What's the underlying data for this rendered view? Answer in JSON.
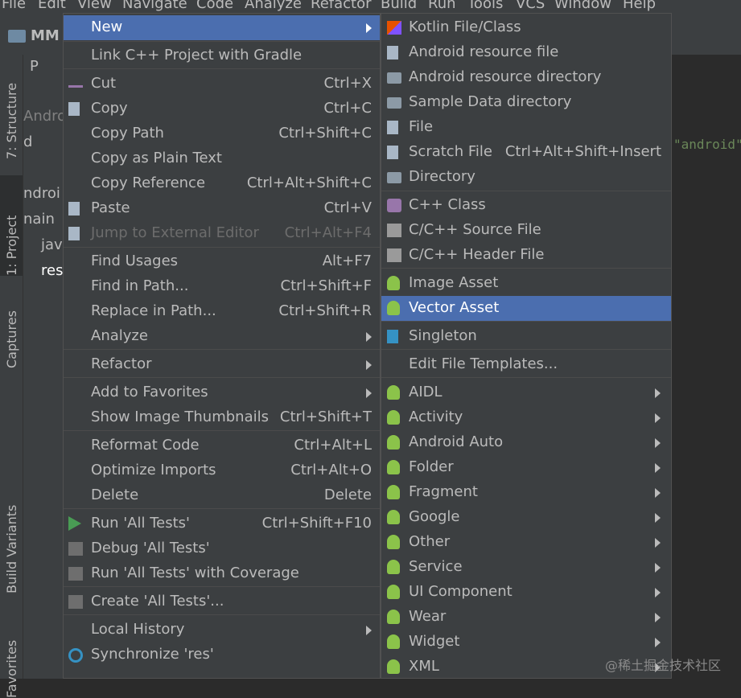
{
  "menubar": [
    "File",
    "Edit",
    "View",
    "Navigate",
    "Code",
    "Analyze",
    "Refactor",
    "Build",
    "Run",
    "Tools",
    "VCS",
    "Window",
    "Help"
  ],
  "project": {
    "name": "MM"
  },
  "side_tabs": [
    "7: Structure",
    "1: Project",
    "Captures",
    "Build Variants",
    "Favorites"
  ],
  "tree_text": [
    "P",
    "Andro",
    "d",
    "ndroi",
    "nain",
    "jav",
    "res"
  ],
  "editor_text": "\"android\"",
  "context_menu": [
    {
      "label": "New",
      "shortcut": "",
      "submenu": true,
      "selected": true
    },
    {
      "label": "Link C++ Project with Gradle",
      "shortcut": ""
    },
    {
      "label": "Cut",
      "shortcut": "Ctrl+X",
      "icon": "scissors-icon"
    },
    {
      "label": "Copy",
      "shortcut": "Ctrl+C",
      "icon": "copy-icon"
    },
    {
      "label": "Copy Path",
      "shortcut": "Ctrl+Shift+C"
    },
    {
      "label": "Copy as Plain Text",
      "shortcut": ""
    },
    {
      "label": "Copy Reference",
      "shortcut": "Ctrl+Alt+Shift+C"
    },
    {
      "label": "Paste",
      "shortcut": "Ctrl+V",
      "icon": "paste-icon"
    },
    {
      "label": "Jump to External Editor",
      "shortcut": "Ctrl+Alt+F4",
      "disabled": true,
      "icon": "external-editor-icon"
    },
    {
      "label": "Find Usages",
      "shortcut": "Alt+F7"
    },
    {
      "label": "Find in Path...",
      "shortcut": "Ctrl+Shift+F"
    },
    {
      "label": "Replace in Path...",
      "shortcut": "Ctrl+Shift+R"
    },
    {
      "label": "Analyze",
      "shortcut": "",
      "submenu": true
    },
    {
      "label": "Refactor",
      "shortcut": "",
      "submenu": true
    },
    {
      "label": "Add to Favorites",
      "shortcut": "",
      "submenu": true
    },
    {
      "label": "Show Image Thumbnails",
      "shortcut": "Ctrl+Shift+T"
    },
    {
      "label": "Reformat Code",
      "shortcut": "Ctrl+Alt+L"
    },
    {
      "label": "Optimize Imports",
      "shortcut": "Ctrl+Alt+O"
    },
    {
      "label": "Delete",
      "shortcut": "Delete"
    },
    {
      "label": "Run 'All Tests'",
      "shortcut": "Ctrl+Shift+F10",
      "icon": "run-icon"
    },
    {
      "label": "Debug 'All Tests'",
      "shortcut": "",
      "icon": "debug-icon"
    },
    {
      "label": "Run 'All Tests' with Coverage",
      "shortcut": "",
      "icon": "coverage-icon"
    },
    {
      "label": "Create 'All Tests'...",
      "shortcut": "",
      "icon": "create-test-icon"
    },
    {
      "label": "Local History",
      "shortcut": "",
      "submenu": true
    },
    {
      "label": "Synchronize 'res'",
      "shortcut": "",
      "icon": "sync-icon"
    }
  ],
  "new_submenu": [
    {
      "label": "Kotlin File/Class",
      "icon": "kotlin-icon"
    },
    {
      "label": "Android resource file",
      "icon": "resource-file-icon"
    },
    {
      "label": "Android resource directory",
      "icon": "folder-icon"
    },
    {
      "label": "Sample Data directory",
      "icon": "folder-icon"
    },
    {
      "label": "File",
      "icon": "file-icon"
    },
    {
      "label": "Scratch File",
      "shortcut": "Ctrl+Alt+Shift+Insert",
      "icon": "scratch-file-icon"
    },
    {
      "label": "Directory",
      "icon": "folder-icon"
    },
    {
      "label": "C++ Class",
      "icon": "cpp-class-icon"
    },
    {
      "label": "C/C++ Source File",
      "icon": "cpp-source-icon"
    },
    {
      "label": "C/C++ Header File",
      "icon": "cpp-header-icon"
    },
    {
      "label": "Image Asset",
      "icon": "android-icon"
    },
    {
      "label": "Vector Asset",
      "icon": "android-icon",
      "selected": true
    },
    {
      "label": "Singleton",
      "icon": "singleton-icon"
    },
    {
      "label": "Edit File Templates...",
      "icon": ""
    },
    {
      "label": "AIDL",
      "icon": "android-icon",
      "submenu": true
    },
    {
      "label": "Activity",
      "icon": "android-icon",
      "submenu": true
    },
    {
      "label": "Android Auto",
      "icon": "android-icon",
      "submenu": true
    },
    {
      "label": "Folder",
      "icon": "android-icon",
      "submenu": true
    },
    {
      "label": "Fragment",
      "icon": "android-icon",
      "submenu": true
    },
    {
      "label": "Google",
      "icon": "android-icon",
      "submenu": true
    },
    {
      "label": "Other",
      "icon": "android-icon",
      "submenu": true
    },
    {
      "label": "Service",
      "icon": "android-icon",
      "submenu": true
    },
    {
      "label": "UI Component",
      "icon": "android-icon",
      "submenu": true
    },
    {
      "label": "Wear",
      "icon": "android-icon",
      "submenu": true
    },
    {
      "label": "Widget",
      "icon": "android-icon",
      "submenu": true
    },
    {
      "label": "XML",
      "icon": "android-icon",
      "submenu": true
    }
  ],
  "watermark": "@稀土掘金技术社区"
}
